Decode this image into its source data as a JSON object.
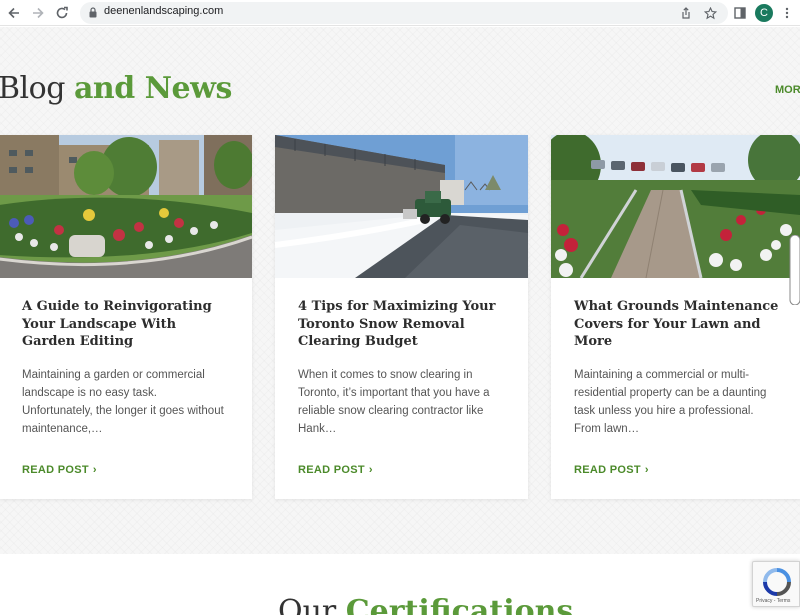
{
  "browser": {
    "url": "deenenlandscaping.com",
    "profile_initial": "C"
  },
  "section": {
    "title_part1": "Blog ",
    "title_part2": "and News",
    "more_label": "MORE"
  },
  "posts": [
    {
      "title": "A Guide to Reinvigorating Your Landscape With Garden Editing",
      "excerpt": "Maintaining a garden or commercial landscape is no easy task. Unfortunately, the longer it goes without maintenance,…",
      "cta": "READ POST"
    },
    {
      "title": "4 Tips for Maximizing Your Toronto Snow Removal Clearing Budget",
      "excerpt": "When it comes to snow clearing in Toronto, it’s important that you have a reliable snow clearing contractor like Hank…",
      "cta": "READ POST"
    },
    {
      "title": "What Grounds Maintenance Covers for Your Lawn and More",
      "excerpt": "Maintaining a commercial or multi-residential property can be a daunting task unless you hire a professional. From lawn…",
      "cta": "READ POST"
    }
  ],
  "certifications": {
    "title_part1": "Our ",
    "title_part2": "Certifications"
  },
  "recaptcha": {
    "label": "Privacy - Terms"
  },
  "colors": {
    "accent_green": "#5b9a3a",
    "link_green": "#4b8a2a",
    "heading_dark": "#333333"
  }
}
